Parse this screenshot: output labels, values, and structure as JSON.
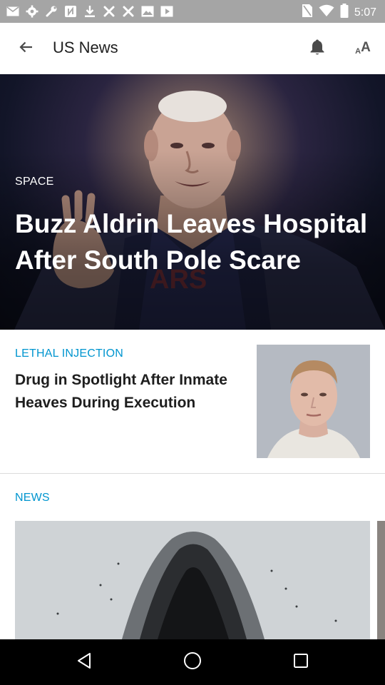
{
  "status_bar": {
    "time": "5:07",
    "icons": [
      "mail-icon",
      "settings-icon",
      "wrench-icon",
      "nfc-icon",
      "download-icon",
      "tools-icon",
      "tools-icon",
      "photo-icon",
      "video-icon",
      "no-sim-icon",
      "wifi-icon",
      "battery-icon"
    ]
  },
  "app_bar": {
    "title": "US News",
    "back_icon": "arrow-back-icon",
    "notification_icon": "bell-icon",
    "text_size_small": "A",
    "text_size_large": "A"
  },
  "hero": {
    "category": "SPACE",
    "title": "Buzz Aldrin Leaves Hospital After South Pole Scare"
  },
  "article": {
    "category": "LETHAL INJECTION",
    "title": "Drug in Spotlight After Inmate Heaves During Execution"
  },
  "section": {
    "label": "NEWS"
  },
  "nav_bar": {
    "icons": [
      "back-triangle-icon",
      "home-circle-icon",
      "recents-square-icon"
    ]
  },
  "colors": {
    "accent": "#0095cf",
    "status_bar": "#a5a5a5",
    "nav_bar": "#000000"
  }
}
